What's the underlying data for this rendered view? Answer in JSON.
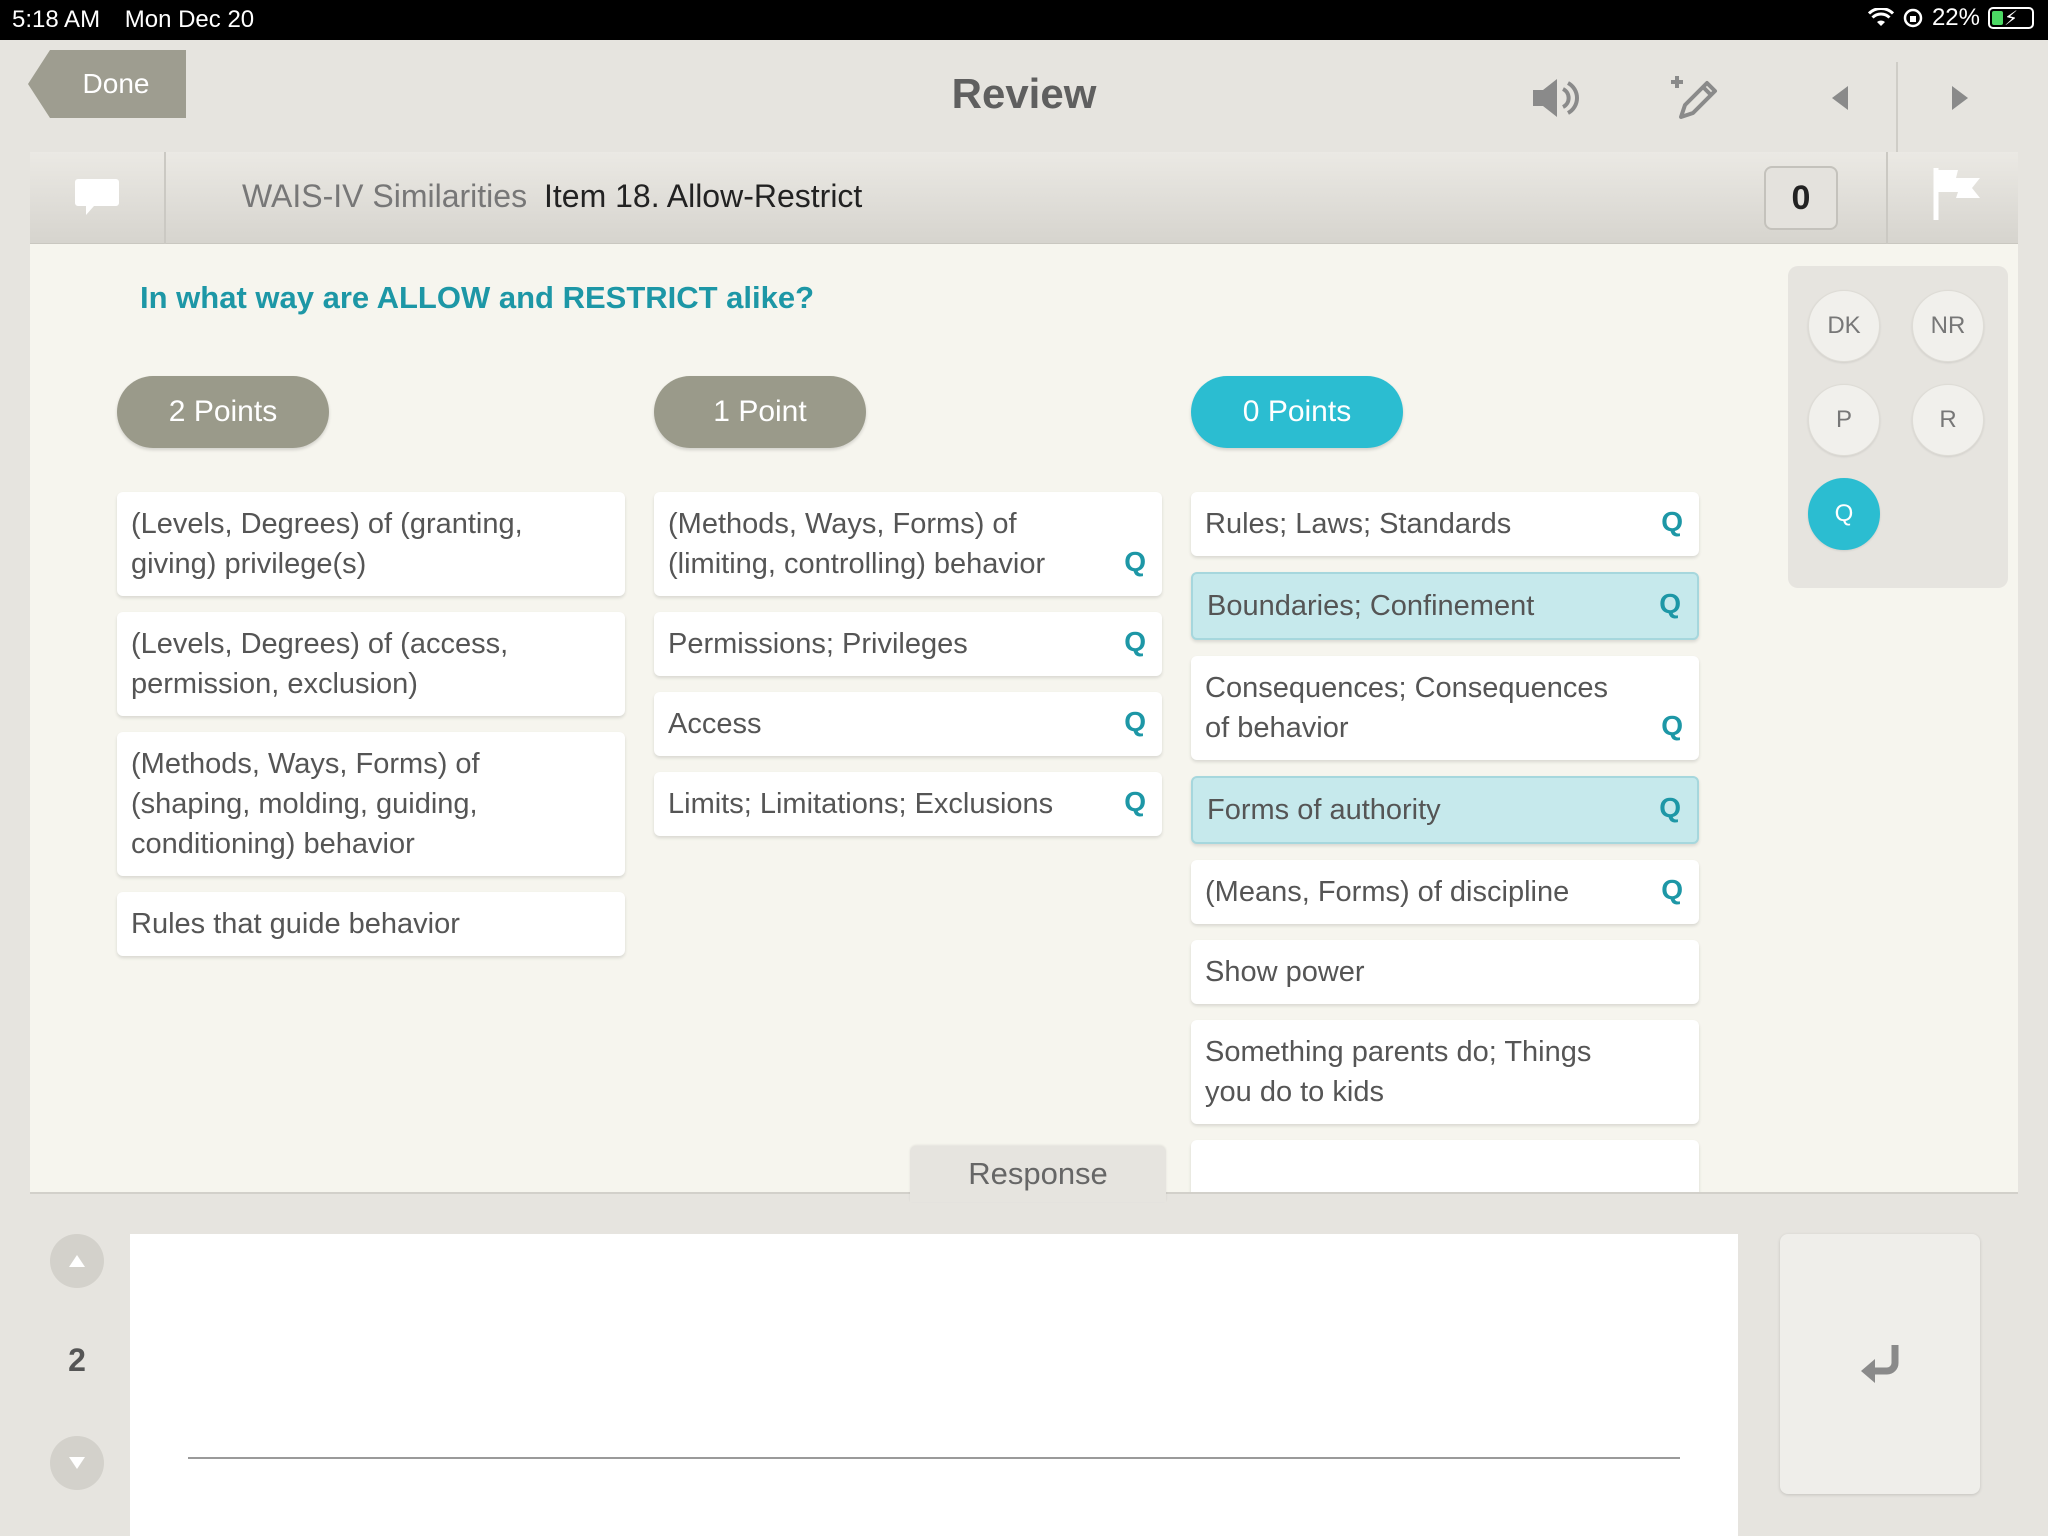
{
  "status_bar": {
    "time": "5:18 AM",
    "date": "Mon Dec 20",
    "battery": "22%"
  },
  "nav": {
    "back_label": "Done",
    "title": "Review"
  },
  "item_header": {
    "subtest": "WAIS-IV Similarities",
    "item": "Item 18. Allow-Restrict",
    "score": "0"
  },
  "question": "In what way are ALLOW and RESTRICT alike?",
  "columns": [
    {
      "label": "2 Points",
      "items": [
        {
          "text": "(Levels, Degrees) of (granting, giving) privilege(s)",
          "q": ""
        },
        {
          "text": "(Levels, Degrees) of (access, permission, exclusion)",
          "q": ""
        },
        {
          "text": "(Methods, Ways, Forms) of (shaping, molding, guiding, conditioning) behavior",
          "q": ""
        },
        {
          "text": "Rules that guide behavior",
          "q": ""
        }
      ]
    },
    {
      "label": "1 Point",
      "items": [
        {
          "text": "(Methods, Ways, Forms) of (limiting, controlling) behavior",
          "q": "Q"
        },
        {
          "text": "Permissions; Privileges",
          "q": "Q"
        },
        {
          "text": "Access",
          "q": "Q"
        },
        {
          "text": "Limits; Limitations; Exclusions",
          "q": "Q"
        }
      ]
    },
    {
      "label": "0 Points",
      "items": [
        {
          "text": "Rules; Laws; Standards",
          "q": "Q"
        },
        {
          "text": "Boundaries; Confinement",
          "q": "Q"
        },
        {
          "text": "Consequences; Consequences of behavior",
          "q": "Q"
        },
        {
          "text": "Forms of authority",
          "q": "Q"
        },
        {
          "text": "(Means, Forms) of discipline",
          "q": "Q"
        },
        {
          "text": "Show power",
          "q": ""
        },
        {
          "text": "Something parents do; Things you do to kids",
          "q": ""
        }
      ]
    }
  ],
  "side_buttons": {
    "dk": "DK",
    "nr": "NR",
    "p": "P",
    "r": "R",
    "q": "Q"
  },
  "response": {
    "tab_label": "Response",
    "number": "2",
    "value": ""
  },
  "colors": {
    "accent": "#2bbdd1",
    "question": "#1d97a6",
    "neutral_pill": "#9a9a8a",
    "highlight": "#c6e9ec"
  }
}
